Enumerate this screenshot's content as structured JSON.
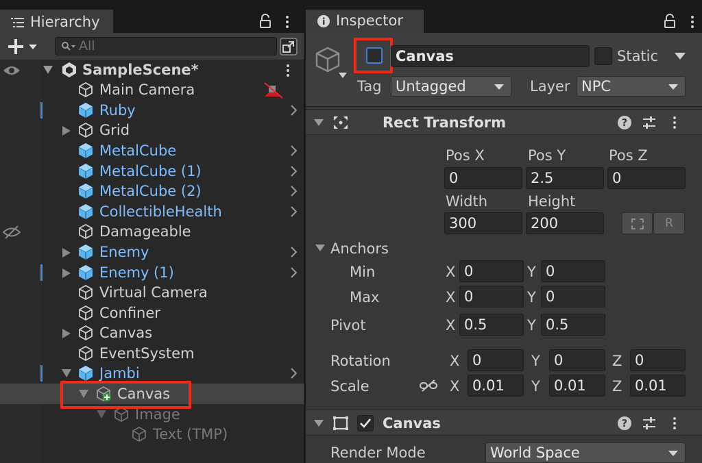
{
  "hierarchy": {
    "tab_title": "Hierarchy",
    "search_placeholder": "All",
    "scene_name": "SampleScene*",
    "items": [
      {
        "label": "Main Camera"
      },
      {
        "label": "Ruby"
      },
      {
        "label": "Grid"
      },
      {
        "label": "MetalCube"
      },
      {
        "label": "MetalCube (1)"
      },
      {
        "label": "MetalCube (2)"
      },
      {
        "label": "CollectibleHealth"
      },
      {
        "label": "Damageable"
      },
      {
        "label": "Enemy"
      },
      {
        "label": "Enemy (1)"
      },
      {
        "label": "Virtual Camera"
      },
      {
        "label": "Confiner"
      },
      {
        "label": "Canvas"
      },
      {
        "label": "EventSystem"
      },
      {
        "label": "Jambi"
      },
      {
        "label": "Canvas"
      },
      {
        "label": "Image"
      },
      {
        "label": "Text (TMP)"
      }
    ]
  },
  "inspector": {
    "tab_title": "Inspector",
    "object_name": "Canvas",
    "active_checked": false,
    "static_label": "Static",
    "tag_label": "Tag",
    "tag_value": "Untagged",
    "layer_label": "Layer",
    "layer_value": "NPC",
    "rect_transform": {
      "title": "Rect Transform",
      "pos_x_label": "Pos X",
      "pos_y_label": "Pos Y",
      "pos_z_label": "Pos Z",
      "pos_x": "0",
      "pos_y": "2.5",
      "pos_z": "0",
      "width_label": "Width",
      "height_label": "Height",
      "width": "300",
      "height": "200",
      "raw_button": "R",
      "anchors_label": "Anchors",
      "min_label": "Min",
      "max_label": "Max",
      "anchor_min_x": "0",
      "anchor_min_y": "0",
      "anchor_max_x": "0",
      "anchor_max_y": "0",
      "pivot_label": "Pivot",
      "pivot_x": "0.5",
      "pivot_y": "0.5",
      "rotation_label": "Rotation",
      "rotation_x": "0",
      "rotation_y": "0",
      "rotation_z": "0",
      "scale_label": "Scale",
      "scale_x": "0.01",
      "scale_y": "0.01",
      "scale_z": "0.01",
      "axis_x": "X",
      "axis_y": "Y",
      "axis_z": "Z"
    },
    "canvas_component": {
      "title": "Canvas",
      "enabled": true,
      "render_mode_label": "Render Mode",
      "render_mode_value": "World Space"
    }
  },
  "colors": {
    "highlight_red": "#f02a14",
    "prefab_blue": "#7cbdff",
    "selection_bar": "#3d8ad8"
  }
}
